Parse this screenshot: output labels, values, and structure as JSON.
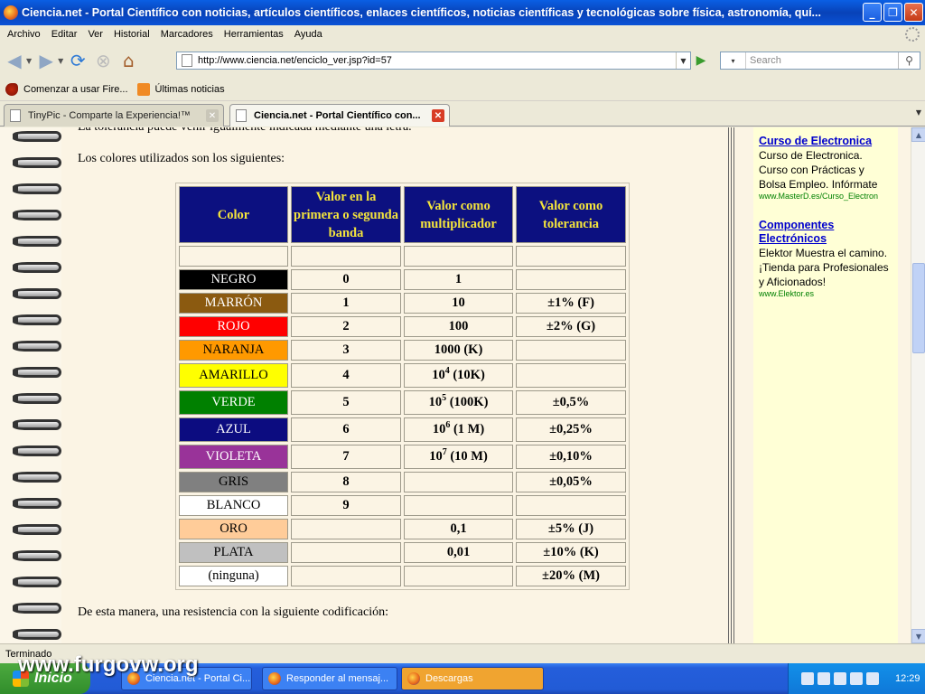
{
  "window": {
    "title": "Ciencia.net - Portal Científico con noticias, artículos científicos, enlaces científicos, noticias científicas y tecnológicas sobre física, astronomía, quí...",
    "minimize": "_",
    "maximize": "❐",
    "close": "✕"
  },
  "menu": [
    "Archivo",
    "Editar",
    "Ver",
    "Historial",
    "Marcadores",
    "Herramientas",
    "Ayuda"
  ],
  "nav": {
    "url": "http://www.ciencia.net/enciclo_ver.jsp?id=57",
    "search_placeholder": "Search"
  },
  "bookmarks": [
    "Comenzar a usar Fire...",
    "Últimas noticias"
  ],
  "tabs": [
    {
      "label": "TinyPic - Comparte la Experiencia!™",
      "active": false
    },
    {
      "label": "Ciencia.net - Portal Científico con...",
      "active": true
    }
  ],
  "content": {
    "cut_line": "La tolerancia puede venir igualmente indicada mediante una letra.",
    "intro": "Los colores utilizados son los siguientes:",
    "conclusion": "De esta manera, una resistencia con la siguiente codificación:",
    "headers": [
      "Color",
      "Valor en la primera o segunda banda",
      "Valor como multiplicador",
      "Valor como tolerancia"
    ],
    "rows": [
      {
        "color": "NEGRO",
        "bg": "#000000",
        "fg": "#ffffff",
        "value": "0",
        "mult": "1",
        "mult_exp": "",
        "mult_suffix": "",
        "tol": ""
      },
      {
        "color": "MARRÓN",
        "bg": "#8b5a10",
        "fg": "#ffffff",
        "value": "1",
        "mult": "10",
        "mult_exp": "",
        "mult_suffix": "",
        "tol": "±1% (F)"
      },
      {
        "color": "ROJO",
        "bg": "#ff0000",
        "fg": "#ffffff",
        "value": "2",
        "mult": "100",
        "mult_exp": "",
        "mult_suffix": "",
        "tol": "±2% (G)"
      },
      {
        "color": "NARANJA",
        "bg": "#ff9900",
        "fg": "#000000",
        "value": "3",
        "mult": "1000 (K)",
        "mult_exp": "",
        "mult_suffix": "",
        "tol": ""
      },
      {
        "color": "AMARILLO",
        "bg": "#ffff00",
        "fg": "#000000",
        "value": "4",
        "mult": "10",
        "mult_exp": "4",
        "mult_suffix": " (10K)",
        "tol": ""
      },
      {
        "color": "VERDE",
        "bg": "#008000",
        "fg": "#ffffff",
        "value": "5",
        "mult": "10",
        "mult_exp": "5",
        "mult_suffix": " (100K)",
        "tol": "±0,5%"
      },
      {
        "color": "AZUL",
        "bg": "#0c0c80",
        "fg": "#ffffff",
        "value": "6",
        "mult": "10",
        "mult_exp": "6",
        "mult_suffix": " (1 M)",
        "tol": "±0,25%"
      },
      {
        "color": "VIOLETA",
        "bg": "#993399",
        "fg": "#ffffff",
        "value": "7",
        "mult": "10",
        "mult_exp": "7",
        "mult_suffix": " (10 M)",
        "tol": "±0,10%"
      },
      {
        "color": "GRIS",
        "bg": "#808080",
        "fg": "#000000",
        "value": "8",
        "mult": "",
        "mult_exp": "",
        "mult_suffix": "",
        "tol": "±0,05%"
      },
      {
        "color": "BLANCO",
        "bg": "#ffffff",
        "fg": "#000000",
        "value": "9",
        "mult": "",
        "mult_exp": "",
        "mult_suffix": "",
        "tol": ""
      },
      {
        "color": "ORO",
        "bg": "#ffcc99",
        "fg": "#000000",
        "value": "",
        "mult": "0,1",
        "mult_exp": "",
        "mult_suffix": "",
        "tol": "±5% (J)"
      },
      {
        "color": "PLATA",
        "bg": "#c0c0c0",
        "fg": "#000000",
        "value": "",
        "mult": "0,01",
        "mult_exp": "",
        "mult_suffix": "",
        "tol": "±10% (K)"
      },
      {
        "color": "(ninguna)",
        "bg": "#ffffff",
        "fg": "#000000",
        "value": "",
        "mult": "",
        "mult_exp": "",
        "mult_suffix": "",
        "tol": "±20% (M)"
      }
    ]
  },
  "ads": [
    {
      "title": "Curso de Electronica",
      "body": "Curso de Electronica. Curso con Prácticas y Bolsa Empleo. Infórmate",
      "url": "www.MasterD.es/Curso_Electron"
    },
    {
      "title": "Componentes Electrónicos",
      "body": "Elektor Muestra el camino. ¡Tienda para Profesionales y Aficionados!",
      "url": "www.Elektor.es"
    }
  ],
  "status": "Terminado",
  "taskbar": {
    "start": "Inicio",
    "tasks": [
      "Ciencia.net - Portal Ci...",
      "Responder al mensaj...",
      "Descargas"
    ],
    "clock": "12:29"
  },
  "watermark": "www.furgovw.org",
  "colors": {
    "table_header_bg": "#0c1080",
    "table_header_fg": "#f5e53b",
    "ad_title": "#0000cc",
    "ad_url": "#008000"
  }
}
